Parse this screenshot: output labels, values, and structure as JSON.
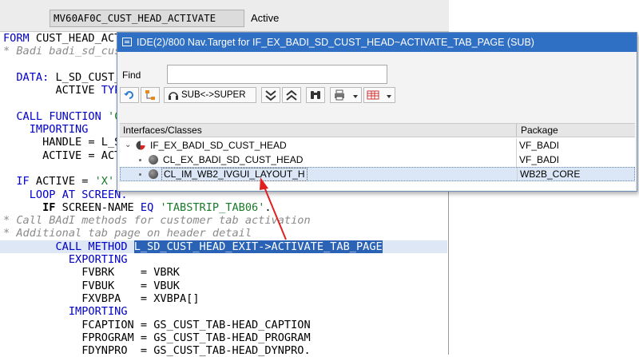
{
  "editor": {
    "program_name": "MV60AF0C_CUST_HEAD_ACTIVATE",
    "status": "Active",
    "code_lines": [
      "FORM CUST_HEAD_ACT",
      "* Badi badi_sd_cus",
      "",
      "  DATA: L_SD_CUST_",
      "        ACTIVE TYP",
      "",
      "  CALL FUNCTION 'C",
      "    IMPORTING",
      "      HANDLE = L_S",
      "      ACTIVE = ACT",
      "",
      "  IF ACTIVE = 'X'.",
      "    LOOP AT SCREEN.",
      "      IF SCREEN-NAME EQ 'TABSTRIP_TAB06'.",
      "* Call BAdI methods for customer tab activation",
      "* Additional tab page on header detail",
      "        CALL METHOD L_SD_CUST_HEAD_EXIT->ACTIVATE_TAB_PAGE",
      "          EXPORTING",
      "            FVBRK    = VBRK",
      "            FVBUK    = VBUK",
      "            FXVBPA   = XVBPA[]",
      "          IMPORTING",
      "            FCAPTION = GS_CUST_TAB-HEAD_CAPTION",
      "            FPROGRAM = GS_CUST_TAB-HEAD_PROGRAM",
      "            FDYNPRO  = GS_CUST_TAB-HEAD_DYNPRO."
    ]
  },
  "popup": {
    "title": "IDE(2)/800 Nav.Target for IF_EX_BADI_SD_CUST_HEAD~ACTIVATE_TAB_PAGE (SUB)",
    "find_label": "Find",
    "find_value": "",
    "toolbar": {
      "sub_super_label": "SUB<->SUPER"
    },
    "columns": {
      "name": "Interfaces/Classes",
      "package": "Package"
    },
    "rows": [
      {
        "name": "IF_EX_BADI_SD_CUST_HEAD",
        "package": "VF_BADI"
      },
      {
        "name": "CL_EX_BADI_SD_CUST_HEAD",
        "package": "VF_BADI"
      },
      {
        "name": "CL_IM_WB2_IVGUI_LAYOUT_H",
        "package": "WB2B_CORE"
      }
    ],
    "icons": [
      "refresh-icon",
      "hierarchy-icon",
      "headset-icon",
      "collapse-all-icon",
      "expand-all-icon",
      "binoculars-icon",
      "print-icon",
      "table-layout-icon",
      "interface-icon",
      "class-icon"
    ]
  },
  "colors": {
    "title_bar": "#2f6fc4",
    "keyword": "#0000c8",
    "comment": "#8a8a8a",
    "string": "#1a7a2a",
    "selection": "#2a62b5",
    "arrow": "#e02020"
  }
}
